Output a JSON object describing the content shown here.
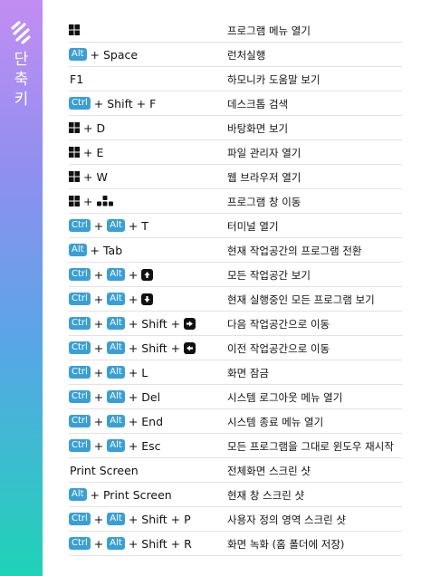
{
  "sidebar": {
    "title_chars": [
      "단",
      "축",
      "키"
    ]
  },
  "colors": {
    "key_badge": "#3a9fd6",
    "gradient_top": "#c28df2",
    "gradient_bottom": "#1fd3b7"
  },
  "rows": [
    {
      "keys": [
        {
          "t": "icon",
          "v": "windows-icon"
        }
      ],
      "desc": "프로그램 메뉴 열기"
    },
    {
      "keys": [
        {
          "t": "kb",
          "v": "Alt"
        },
        {
          "t": "txt",
          "v": "+ Space"
        }
      ],
      "desc": "런처실행"
    },
    {
      "keys": [
        {
          "t": "txt",
          "v": "F1"
        }
      ],
      "desc": "하모니카 도움말 보기"
    },
    {
      "keys": [
        {
          "t": "kb",
          "v": "Ctrl"
        },
        {
          "t": "txt",
          "v": "+ Shift + F"
        }
      ],
      "desc": "데스크톱 검색"
    },
    {
      "keys": [
        {
          "t": "icon",
          "v": "windows-icon"
        },
        {
          "t": "txt",
          "v": "+ D"
        }
      ],
      "desc": "바탕화면 보기"
    },
    {
      "keys": [
        {
          "t": "icon",
          "v": "windows-icon"
        },
        {
          "t": "txt",
          "v": "+ E"
        }
      ],
      "desc": "파일 관리자 열기"
    },
    {
      "keys": [
        {
          "t": "icon",
          "v": "windows-icon"
        },
        {
          "t": "txt",
          "v": "+ W"
        }
      ],
      "desc": "웹 브라우저 열기"
    },
    {
      "keys": [
        {
          "t": "icon",
          "v": "windows-icon"
        },
        {
          "t": "txt",
          "v": "+"
        },
        {
          "t": "icon",
          "v": "arrow-cluster-icon"
        }
      ],
      "desc": "프로그램 창 이동"
    },
    {
      "keys": [
        {
          "t": "kb",
          "v": "Ctrl"
        },
        {
          "t": "txt",
          "v": "+"
        },
        {
          "t": "kb",
          "v": "Alt"
        },
        {
          "t": "txt",
          "v": "+ T"
        }
      ],
      "desc": "터미널 열기"
    },
    {
      "keys": [
        {
          "t": "kb",
          "v": "Alt"
        },
        {
          "t": "txt",
          "v": "+ Tab"
        }
      ],
      "desc": "현재 작업공간의 프로그램 전환"
    },
    {
      "keys": [
        {
          "t": "kb",
          "v": "Ctrl"
        },
        {
          "t": "txt",
          "v": "+"
        },
        {
          "t": "kb",
          "v": "Alt"
        },
        {
          "t": "txt",
          "v": "+"
        },
        {
          "t": "icon",
          "v": "arrow-up-key-icon"
        }
      ],
      "desc": "모든 작업공간 보기"
    },
    {
      "keys": [
        {
          "t": "kb",
          "v": "Ctrl"
        },
        {
          "t": "txt",
          "v": "+"
        },
        {
          "t": "kb",
          "v": "Alt"
        },
        {
          "t": "txt",
          "v": "+"
        },
        {
          "t": "icon",
          "v": "arrow-down-key-icon"
        }
      ],
      "desc": "현재 실행중인 모든 프로그램 보기"
    },
    {
      "keys": [
        {
          "t": "kb",
          "v": "Ctrl"
        },
        {
          "t": "txt",
          "v": "+"
        },
        {
          "t": "kb",
          "v": "Alt"
        },
        {
          "t": "txt",
          "v": "+ Shift +"
        },
        {
          "t": "icon",
          "v": "arrow-right-key-icon"
        }
      ],
      "desc": "다음 작업공간으로 이동"
    },
    {
      "keys": [
        {
          "t": "kb",
          "v": "Ctrl"
        },
        {
          "t": "txt",
          "v": "+"
        },
        {
          "t": "kb",
          "v": "Alt"
        },
        {
          "t": "txt",
          "v": "+ Shift +"
        },
        {
          "t": "icon",
          "v": "arrow-left-key-icon"
        }
      ],
      "desc": "이전 작업공간으로 이동"
    },
    {
      "keys": [
        {
          "t": "kb",
          "v": "Ctrl"
        },
        {
          "t": "txt",
          "v": "+"
        },
        {
          "t": "kb",
          "v": "Alt"
        },
        {
          "t": "txt",
          "v": "+ L"
        }
      ],
      "desc": "화면 잠금"
    },
    {
      "keys": [
        {
          "t": "kb",
          "v": "Ctrl"
        },
        {
          "t": "txt",
          "v": "+"
        },
        {
          "t": "kb",
          "v": "Alt"
        },
        {
          "t": "txt",
          "v": "+ Del"
        }
      ],
      "desc": "시스템 로그아웃 메뉴 열기"
    },
    {
      "keys": [
        {
          "t": "kb",
          "v": "Ctrl"
        },
        {
          "t": "txt",
          "v": "+"
        },
        {
          "t": "kb",
          "v": "Alt"
        },
        {
          "t": "txt",
          "v": "+ End"
        }
      ],
      "desc": "시스템 종료 메뉴 열기"
    },
    {
      "keys": [
        {
          "t": "kb",
          "v": "Ctrl"
        },
        {
          "t": "txt",
          "v": "+"
        },
        {
          "t": "kb",
          "v": "Alt"
        },
        {
          "t": "txt",
          "v": "+ Esc"
        }
      ],
      "desc": "모든 프로그램을 그대로 윈도우 재시작"
    },
    {
      "keys": [
        {
          "t": "txt",
          "v": "Print Screen"
        }
      ],
      "desc": "전체화면 스크린 샷"
    },
    {
      "keys": [
        {
          "t": "kb",
          "v": "Alt"
        },
        {
          "t": "txt",
          "v": "+ Print Screen"
        }
      ],
      "desc": "현재 창 스크린 샷"
    },
    {
      "keys": [
        {
          "t": "kb",
          "v": "Ctrl"
        },
        {
          "t": "txt",
          "v": "+"
        },
        {
          "t": "kb",
          "v": "Alt"
        },
        {
          "t": "txt",
          "v": "+ Shift + P"
        }
      ],
      "desc": "사용자 정의 영역 스크린 샷"
    },
    {
      "keys": [
        {
          "t": "kb",
          "v": "Ctrl"
        },
        {
          "t": "txt",
          "v": "+"
        },
        {
          "t": "kb",
          "v": "Alt"
        },
        {
          "t": "txt",
          "v": "+ Shift + R"
        }
      ],
      "desc": "화면 녹화 (홈 폴더에 저장)"
    }
  ]
}
